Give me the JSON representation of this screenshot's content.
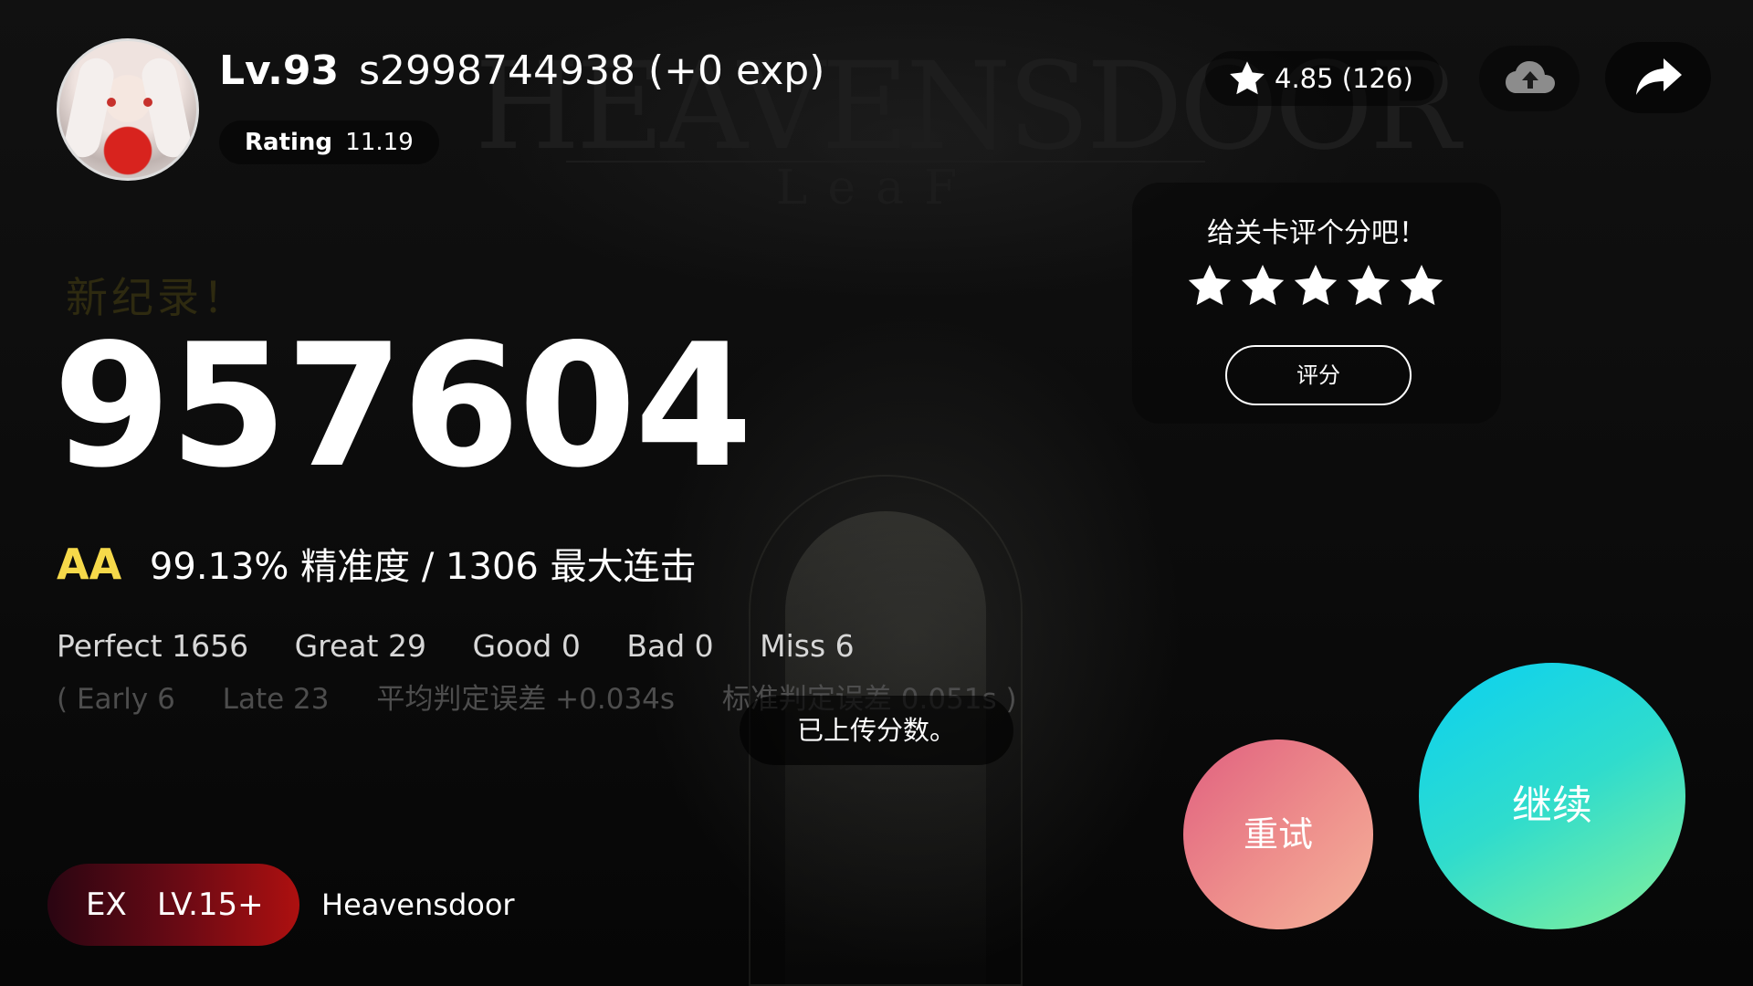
{
  "background": {
    "title": "HEAVENSDOOR",
    "subtitle": "LeaF"
  },
  "player": {
    "level": "Lv.93",
    "name_exp": "s2998744938 (+0 exp)",
    "rating_label": "Rating",
    "rating_value": "11.19"
  },
  "level_rating": {
    "score": "4.85 (126)"
  },
  "result": {
    "new_record": "新纪录！",
    "score": "957604",
    "grade": "AA",
    "accuracy_combo": "99.13% 精准度 / 1306 最大连击",
    "judgements": [
      "Perfect 1656",
      "Great 29",
      "Good 0",
      "Bad 0",
      "Miss 6"
    ],
    "details": [
      "( Early 6",
      "Late 23",
      "平均判定误差 +0.034s",
      "标准判定误差 0.051s )"
    ]
  },
  "toast": "已上传分数。",
  "rate_panel": {
    "prompt": "给关卡评个分吧！",
    "star_count": 5,
    "button": "评分"
  },
  "song": {
    "difficulty": "EX",
    "level": "LV.15+",
    "title": "Heavensdoor"
  },
  "actions": {
    "retry": "重试",
    "continue": "继续"
  },
  "colors": {
    "grade": "#f6d94a",
    "retry_gradient": [
      "#e0607f",
      "#f5b39a"
    ],
    "continue_gradient": [
      "#0ad0f2",
      "#86f19a"
    ],
    "difficulty_gradient": [
      "#2a0512",
      "#ad1010"
    ]
  },
  "icons": {
    "rating": "star-icon",
    "upload": "cloud-upload-icon",
    "share": "share-arrow-icon"
  }
}
